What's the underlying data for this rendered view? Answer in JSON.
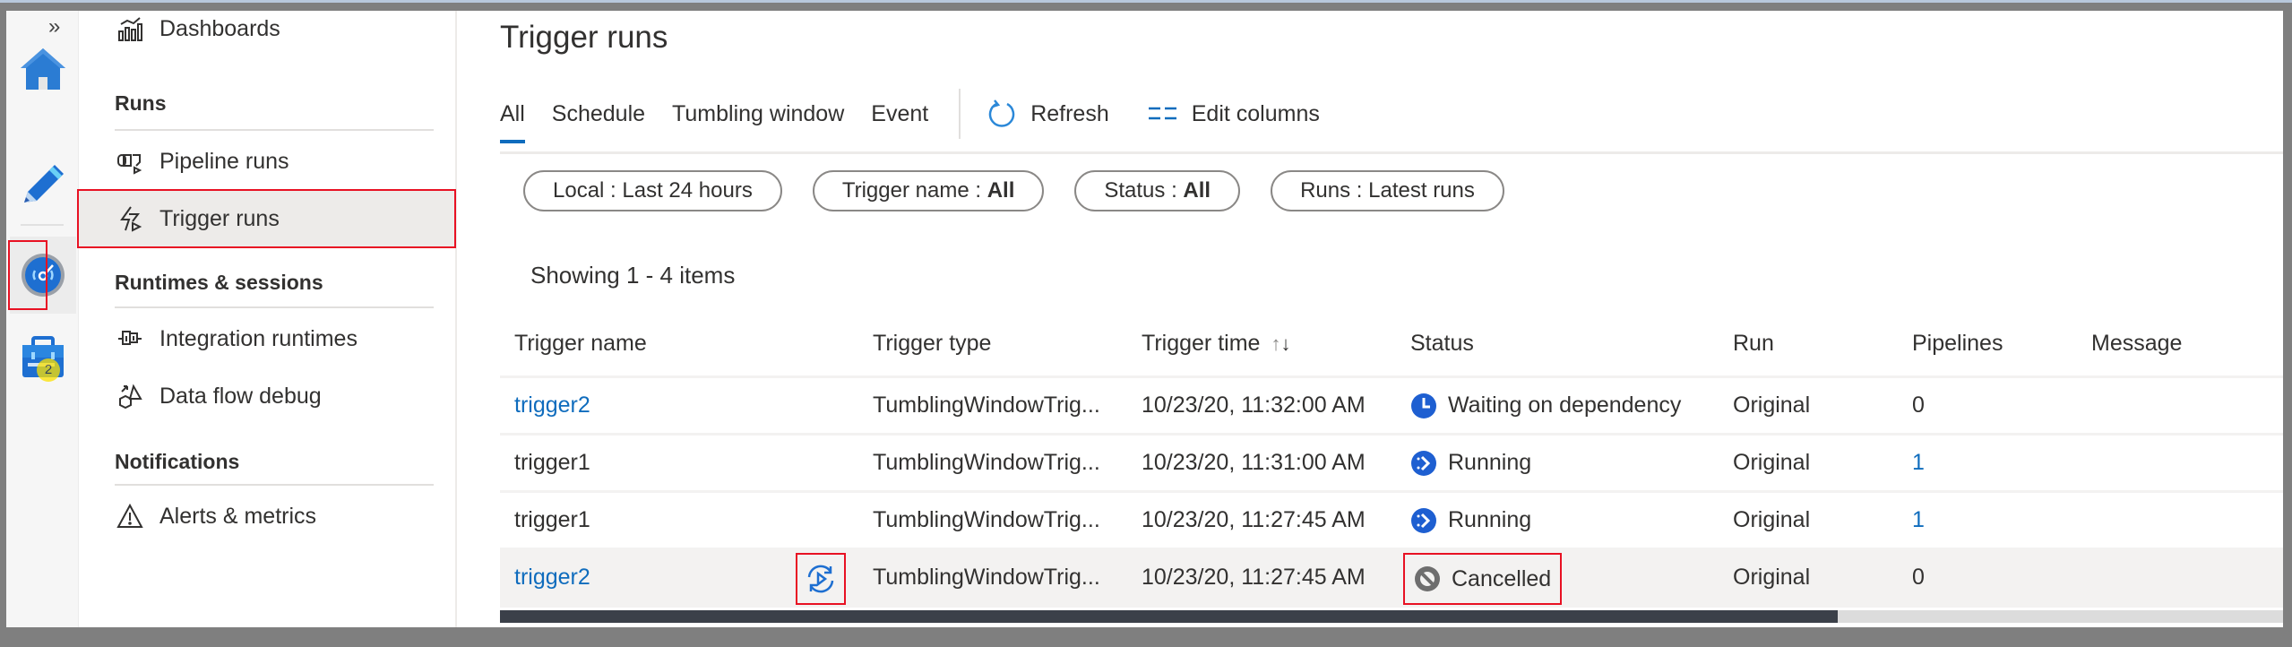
{
  "rail": {
    "expand_label": "»",
    "items": [
      {
        "name": "home",
        "icon": "home-icon"
      },
      {
        "name": "author",
        "icon": "pencil-icon"
      },
      {
        "name": "monitor",
        "icon": "monitor-gauge-icon",
        "selected": true
      },
      {
        "name": "manage",
        "icon": "toolbox-icon",
        "badge": "2"
      }
    ]
  },
  "nav": {
    "top_item": {
      "label": "Dashboards",
      "icon": "dashboard-icon"
    },
    "sections": [
      {
        "heading": "Runs",
        "items": [
          {
            "label": "Pipeline runs",
            "icon": "pipeline-runs-icon"
          },
          {
            "label": "Trigger runs",
            "icon": "trigger-icon",
            "active": true
          }
        ]
      },
      {
        "heading": "Runtimes & sessions",
        "items": [
          {
            "label": "Integration runtimes",
            "icon": "integration-runtime-icon"
          },
          {
            "label": "Data flow debug",
            "icon": "data-flow-debug-icon"
          }
        ]
      },
      {
        "heading": "Notifications",
        "items": [
          {
            "label": "Alerts & metrics",
            "icon": "warning-icon"
          }
        ]
      }
    ]
  },
  "main": {
    "title": "Trigger runs",
    "tabs": [
      {
        "label": "All",
        "active": true
      },
      {
        "label": "Schedule"
      },
      {
        "label": "Tumbling window"
      },
      {
        "label": "Event"
      }
    ],
    "commands": {
      "refresh": "Refresh",
      "edit_columns": "Edit columns"
    },
    "filters": [
      {
        "key": "Local",
        "sep": " : ",
        "value": "Last 24 hours",
        "bold": false
      },
      {
        "key": "Trigger name",
        "sep": " : ",
        "value": "All",
        "bold": true
      },
      {
        "key": "Status",
        "sep": " : ",
        "value": "All",
        "bold": true
      },
      {
        "key": "Runs",
        "sep": " : ",
        "value": "Latest runs",
        "bold": false
      }
    ],
    "showing": "Showing 1 - 4 items",
    "table": {
      "columns": [
        "Trigger name",
        "Trigger type",
        "Trigger time",
        "Status",
        "Run",
        "Pipelines",
        "Message"
      ],
      "sort_icon": "↑↓",
      "rows": [
        {
          "name": "trigger2",
          "name_link": true,
          "type": "TumblingWindowTrig...",
          "time": "10/23/20, 11:32:00 AM",
          "status": "Waiting on dependency",
          "status_icon": "clock-icon",
          "run": "Original",
          "pipelines": "0",
          "pipelines_link": false,
          "message": ""
        },
        {
          "name": "trigger1",
          "name_link": false,
          "type": "TumblingWindowTrig...",
          "time": "10/23/20, 11:31:00 AM",
          "status": "Running",
          "status_icon": "running-icon",
          "run": "Original",
          "pipelines": "1",
          "pipelines_link": true,
          "message": ""
        },
        {
          "name": "trigger1",
          "name_link": false,
          "type": "TumblingWindowTrig...",
          "time": "10/23/20, 11:27:45 AM",
          "status": "Running",
          "status_icon": "running-icon",
          "run": "Original",
          "pipelines": "1",
          "pipelines_link": true,
          "message": ""
        },
        {
          "name": "trigger2",
          "name_link": true,
          "type": "TumblingWindowTrig...",
          "time": "10/23/20, 11:27:45 AM",
          "status": "Cancelled",
          "status_icon": "cancelled-icon",
          "run": "Original",
          "pipelines": "0",
          "pipelines_link": false,
          "message": "",
          "rerun_icon": "rerun-icon",
          "highlighted": true
        }
      ]
    },
    "scroll": {
      "horizontal_position": 0,
      "visible_fraction": 0.75
    }
  },
  "colors": {
    "accent": "#0f6cbd",
    "highlight_box": "#e81123",
    "badge": "#fce100",
    "cancelled": "#6e6e6e"
  }
}
